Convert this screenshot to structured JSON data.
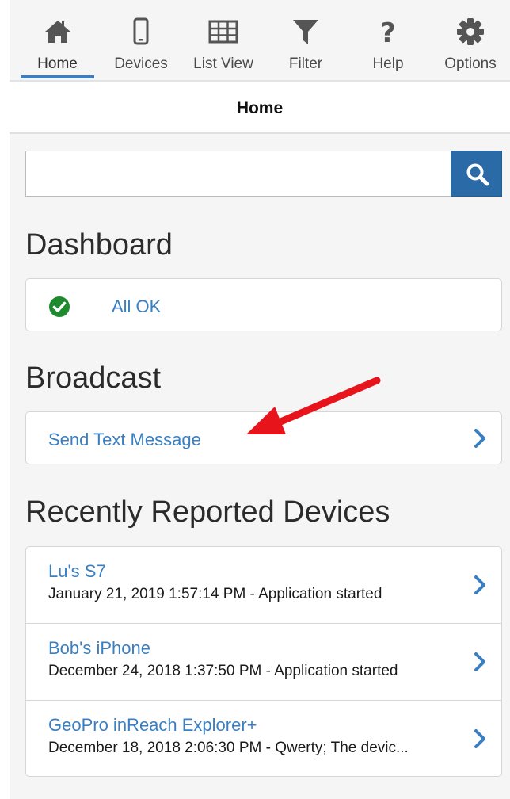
{
  "colors": {
    "accent": "#3a7fc1",
    "search_button": "#2a6aa7",
    "ok_green": "#1e8a2e",
    "annotation_arrow": "#e8141c"
  },
  "toolbar": {
    "items": [
      {
        "label": "Home",
        "icon": "home-icon",
        "active": true
      },
      {
        "label": "Devices",
        "icon": "phone-icon"
      },
      {
        "label": "List View",
        "icon": "table-icon"
      },
      {
        "label": "Filter",
        "icon": "filter-icon"
      },
      {
        "label": "Help",
        "icon": "help-icon"
      },
      {
        "label": "Options",
        "icon": "gear-icon"
      }
    ]
  },
  "header": {
    "title": "Home"
  },
  "search": {
    "value": "",
    "placeholder": "",
    "button_icon": "search-icon"
  },
  "dashboard": {
    "heading": "Dashboard",
    "status_label": "All OK",
    "status_icon": "check-circle-icon"
  },
  "broadcast": {
    "heading": "Broadcast",
    "action_label": "Send Text Message",
    "action_icon": "chevron-right-icon"
  },
  "recent": {
    "heading": "Recently Reported Devices",
    "devices": [
      {
        "name": "Lu's S7",
        "detail": "January 21, 2019 1:57:14 PM - Application started"
      },
      {
        "name": "Bob's iPhone",
        "detail": "December 24, 2018 1:37:50 PM - Application started"
      },
      {
        "name": "GeoPro inReach Explorer+",
        "detail": "December 18, 2018 2:06:30 PM - Qwerty; The devic..."
      }
    ]
  },
  "annotation": {
    "arrow_icon": "red-arrow-icon"
  }
}
